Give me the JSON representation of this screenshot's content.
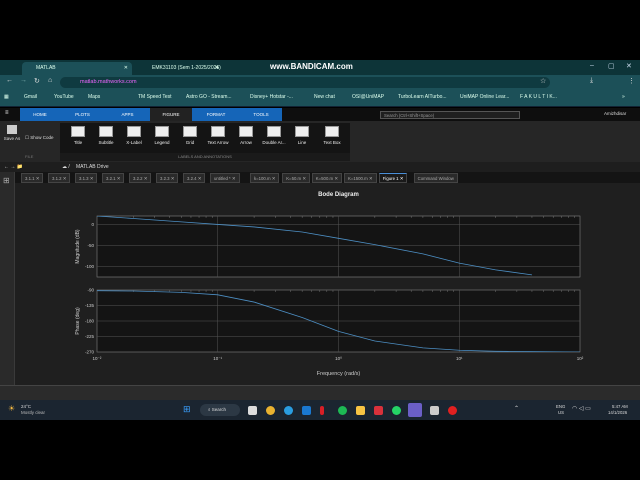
{
  "browser": {
    "tabs": [
      {
        "label": "MATLAB",
        "active": true
      },
      {
        "label": "EMK31103 (Sem 1-2025/2026)",
        "active": false
      }
    ],
    "new_tab": "+",
    "url": "matlab.mathworks.com",
    "bookmarks": [
      "Gmail",
      "YouTube",
      "Maps",
      "TM Speed Test",
      "Astro GO - Stream...",
      "Disney+ Hotstar -...",
      "New chat",
      "OSI@UniMAP",
      "TurboLearn AITurbo...",
      "UniMAP Online Lear...",
      "F A K U L T I  K..."
    ],
    "more": "»",
    "profile": "Amizhdisar"
  },
  "watermark": "www.BANDICAM.com",
  "matlab": {
    "tabs": [
      "HOME",
      "PLOTS",
      "APPS",
      "FIGURE",
      "FORMAT",
      "TOOLS"
    ],
    "active_tab": "FIGURE",
    "search_placeholder": "Search (Ctrl+Shift+Space)",
    "save_as": "Save As",
    "show_code": "Show Code",
    "file_label": "FILE",
    "ribbon_buttons": [
      "Title",
      "Subtitle",
      "X-Label",
      "Legend",
      "Grid",
      "Text Arrow",
      "Arrow",
      "Double Ar...",
      "Line",
      "Text Box"
    ],
    "group_label": "LABELS AND ANNOTATIONS",
    "path": "MATLAB Drive",
    "doc_tabs": [
      "3.1.1",
      "3.1.2",
      "3.1.3",
      "3.2.1",
      "3.2.2",
      "3.2.3",
      "3.2.4",
      "untitled *",
      "k=100.m",
      "K=50.m",
      "K=500.m",
      "K=1500.m",
      "Figure 1",
      "Command Window"
    ],
    "active_doc": "Figure 1"
  },
  "chart_data": {
    "type": "line",
    "title": "Bode Diagram",
    "xlabel": "Frequency (rad/s)",
    "xscale": "log",
    "xlim": [
      0.01,
      100
    ],
    "xticks": [
      0.01,
      0.1,
      1,
      10,
      100
    ],
    "xtick_labels": [
      "10⁻²",
      "10⁻¹",
      "10⁰",
      "10¹",
      "10²"
    ],
    "grid": true,
    "color": "#4d8fc4",
    "panels": [
      {
        "ylabel": "Magnitude (dB)",
        "ylim": [
          -125,
          20
        ],
        "yticks": [
          0,
          -50,
          -100
        ],
        "ytick_labels": [
          "0",
          "-50",
          "-100"
        ],
        "x": [
          0.01,
          0.02,
          0.05,
          0.1,
          0.2,
          0.5,
          1,
          2,
          5,
          10,
          20,
          40
        ],
        "y": [
          20,
          14,
          6,
          0,
          -6,
          -18,
          -33,
          -48,
          -70,
          -92,
          -108,
          -120
        ]
      },
      {
        "ylabel": "Phase (deg)",
        "ylim": [
          -270,
          -90
        ],
        "yticks": [
          -90,
          -135,
          -180,
          -225,
          -270
        ],
        "ytick_labels": [
          "-90",
          "-135",
          "-180",
          "-225",
          "-270"
        ],
        "x": [
          0.01,
          0.02,
          0.05,
          0.1,
          0.2,
          0.5,
          1,
          2,
          5,
          10,
          20,
          100
        ],
        "y": [
          -92,
          -93,
          -97,
          -104,
          -125,
          -170,
          -210,
          -238,
          -258,
          -265,
          -268,
          -270
        ]
      }
    ]
  },
  "taskbar": {
    "weather_temp": "24°C",
    "weather_desc": "Mostly clear",
    "search": "Search",
    "lang": "ENG",
    "region": "US",
    "time": "5:47 AM",
    "date": "14/1/2026"
  }
}
